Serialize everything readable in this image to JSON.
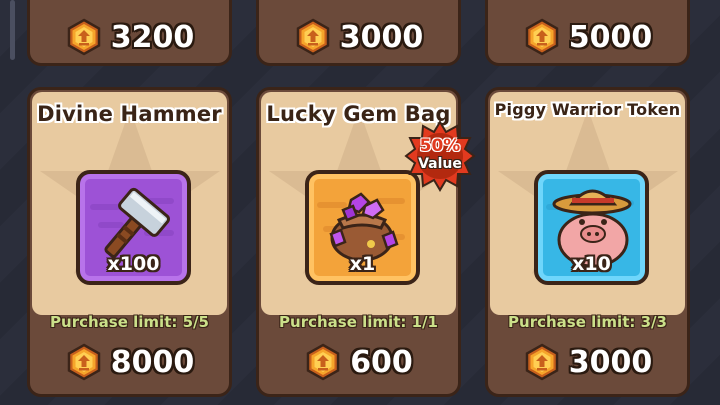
{
  "currency_icon": "coin-icon",
  "colors": {
    "card_border": "#3b2418",
    "card_body": "#e8caa0",
    "card_footer": "#6b4a3a",
    "limit_text": "#cbe08a",
    "badge_red": "#e23a1f"
  },
  "top_row": [
    {
      "price": "3200"
    },
    {
      "price": "3000"
    },
    {
      "price": "5000"
    }
  ],
  "items": [
    {
      "title": "Divine Hammer",
      "icon": "hammer-icon",
      "quantity": "x100",
      "limit": "Purchase limit: 5/5",
      "price": "8000"
    },
    {
      "title": "Lucky Gem Bag",
      "icon": "gem-bag-icon",
      "quantity": "x1",
      "limit": "Purchase limit: 1/1",
      "price": "600",
      "badge": {
        "percent": "50%",
        "label": "Value"
      }
    },
    {
      "title": "Piggy Warrior Token",
      "icon": "piggy-warrior-icon",
      "quantity": "x10",
      "limit": "Purchase limit: 3/3",
      "price": "3000"
    }
  ]
}
